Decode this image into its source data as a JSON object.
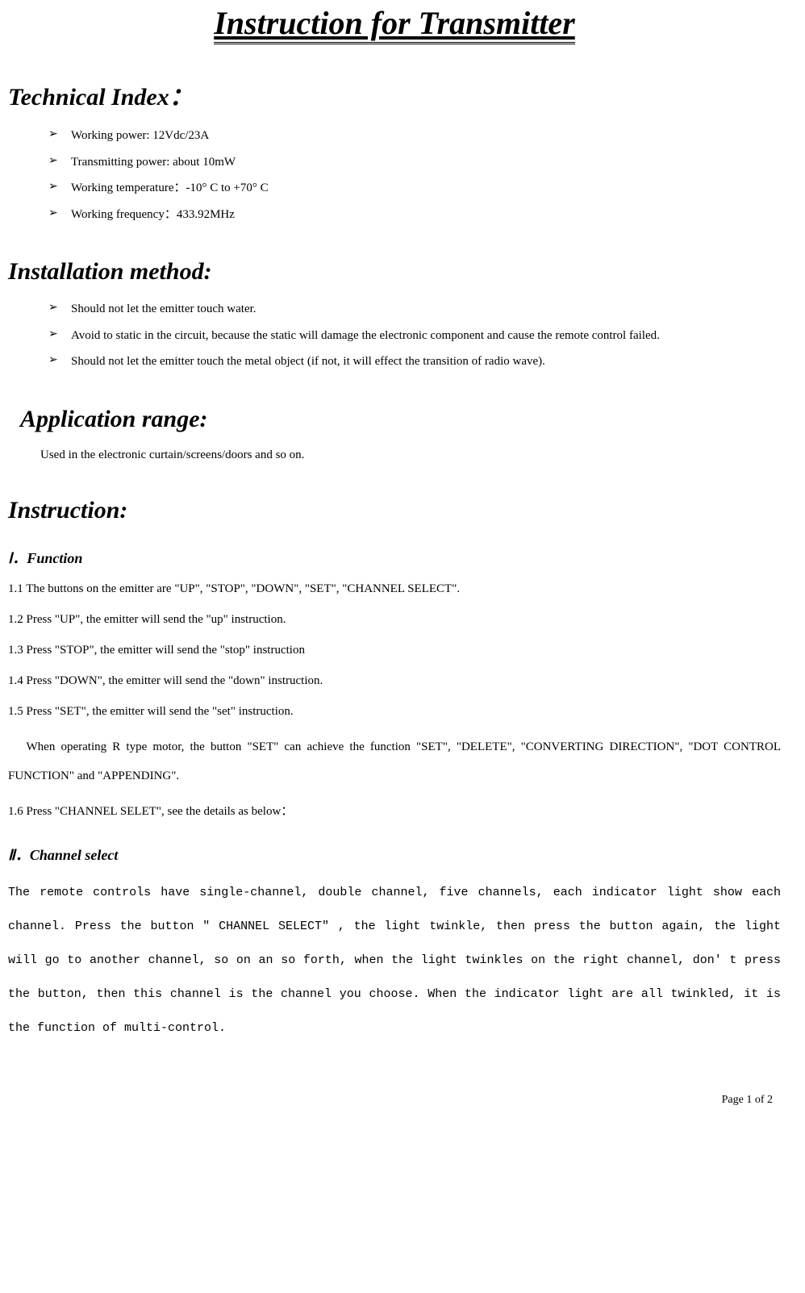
{
  "title": "Instruction for Transmitter",
  "sections": {
    "technical": {
      "heading": "Technical Index：",
      "items": [
        "Working power: 12Vdc/23A",
        "Transmitting power: about 10mW",
        "Working temperature：-10°  C to    +70°  C",
        "Working frequency：433.92MHz"
      ]
    },
    "installation": {
      "heading": "Installation method:",
      "items": [
        "Should not let the emitter touch water.",
        "Avoid to static in the circuit, because the static will damage the electronic component and cause the remote control failed.",
        "Should not let the emitter touch the metal object (if not, it will effect the transition of radio wave)."
      ]
    },
    "application": {
      "heading": "Application range:",
      "text": "Used in the electronic curtain/screens/doors and so on."
    },
    "instruction": {
      "heading": "Instruction:",
      "function": {
        "heading": "Ⅰ．Function",
        "lines": [
          "1.1 The buttons on the emitter are \"UP\", \"STOP\", \"DOWN\", \"SET\", \"CHANNEL SELECT\".",
          "1.2 Press \"UP\", the emitter will send the \"up\" instruction.",
          "1.3 Press \"STOP\", the emitter will send the \"stop\" instruction",
          "1.4 Press \"DOWN\", the emitter will send the \"down\" instruction.",
          "1.5 Press \"SET\", the emitter will send the \"set\" instruction."
        ],
        "para": "When operating R type motor, the button \"SET\" can achieve the function \"SET\", \"DELETE\", \"CONVERTING DIRECTION\", \"DOT CONTROL FUNCTION\" and \"APPENDING\".",
        "line6": "1.6 Press \"CHANNEL SELET\", see the details as below："
      },
      "channel": {
        "heading": "Ⅱ．Channel select",
        "para": "The remote controls have single-channel, double channel, five channels, each indicator light show each channel. Press the button \" CHANNEL SELECT\" , the light twinkle, then press the button again, the light will go to another channel, so on an so forth, when the light twinkles on the right channel, don' t press the button, then this channel is the channel you choose. When the indicator light are all twinkled, it is the function of multi-control."
      }
    }
  },
  "footer": "Page 1 of 2"
}
